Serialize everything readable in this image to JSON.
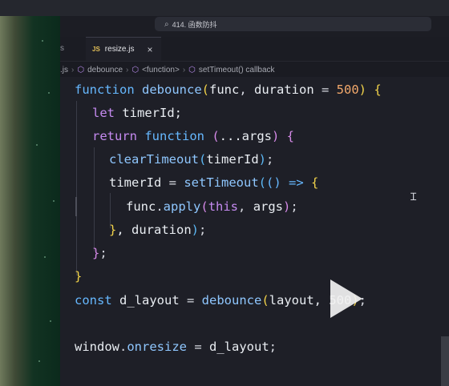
{
  "search": {
    "icon": "search-icon",
    "text": "414. 函数防抖"
  },
  "tabs": {
    "left_partial": "s",
    "active": {
      "badge": "JS",
      "label": "resize.js",
      "close": "×"
    }
  },
  "breadcrumb": {
    "partial": ".js",
    "items": [
      "debounce",
      "<function>",
      "setTimeout() callback"
    ]
  },
  "code": {
    "l1": {
      "kw": "function",
      "name": "debounce",
      "open": "(",
      "p1": "func",
      "comma": ", ",
      "p2": "duration",
      "eq": " = ",
      "num": "500",
      "close": ")",
      "brace": " {"
    },
    "l2": {
      "kw": "let",
      "name": " timerId;"
    },
    "l3": {
      "kw": "return",
      "kw2": " function",
      "open": " (",
      "rest": "...args",
      "close": ")",
      "brace": " {"
    },
    "l4": {
      "fn": "clearTimeout",
      "open": "(",
      "arg": "timerId",
      "close": ")",
      "semi": ";"
    },
    "l5": {
      "var": "timerId",
      "eq": " = ",
      "fn": "setTimeout",
      "open": "(",
      "arrow": "() =>",
      "brace": " {"
    },
    "l6": {
      "obj": "func",
      "dot": ".",
      "fn": "apply",
      "open": "(",
      "this": "this",
      "comma": ", ",
      "arg": "args",
      "close": ")",
      "semi": ";"
    },
    "l7": {
      "brace": "}",
      "rest": ", duration",
      "close": ")",
      "semi": ";"
    },
    "l8": {
      "brace": "}",
      "semi": ";"
    },
    "l9": {
      "brace": "}"
    },
    "l10": {
      "kw": "const",
      "var": " d_layout",
      "eq": " = ",
      "fn": "debounce",
      "open": "(",
      "arg": "layout, 500",
      "close": ")",
      "semi": ";"
    },
    "l11": {
      "obj": "window",
      "dot": ".",
      "prop": "onresize",
      "eq": " = ",
      "var": "d_layout",
      "semi": ";"
    }
  }
}
